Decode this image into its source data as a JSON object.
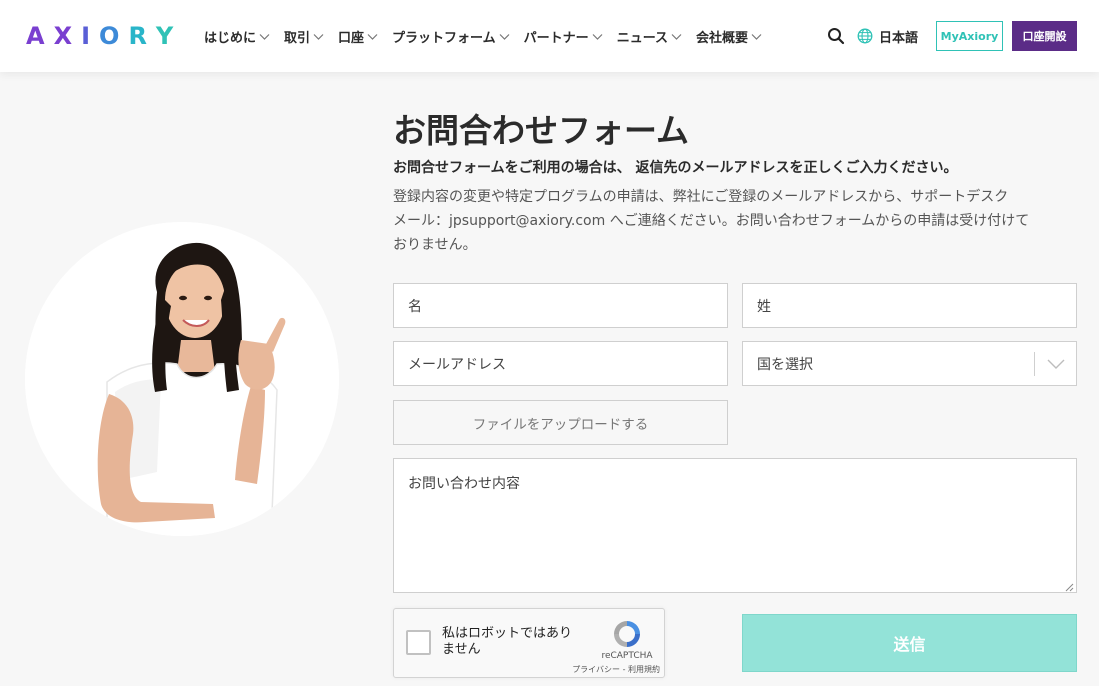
{
  "header": {
    "logo_letters": [
      "A",
      "X",
      "I",
      "O",
      "R",
      "Y"
    ],
    "logo_colors": [
      "#7a3fd0",
      "#7a3fd0",
      "#5a5fd6",
      "#3d8ad8",
      "#29b5c9",
      "#2fc2b6"
    ],
    "nav": [
      {
        "label": "はじめに"
      },
      {
        "label": "取引"
      },
      {
        "label": "口座"
      },
      {
        "label": "プラットフォーム"
      },
      {
        "label": "パートナー"
      },
      {
        "label": "ニュース"
      },
      {
        "label": "会社概要"
      }
    ],
    "language": "日本語",
    "myaxiory_label": "MyAxiory",
    "open_account_label": "口座開設",
    "brand_purple": "#5b2c87",
    "brand_teal": "#2fc2b6"
  },
  "main": {
    "title": "お問合わせフォーム",
    "lead": "お問合せフォームをご利用の場合は、 返信先のメールアドレスを正しくご入力ください。",
    "description_lines": [
      "登録内容の変更や特定プログラムの申請は、弊社にご登録のメールアドレスから、サポートデスク",
      "メール：jpsupport@axiory.com へご連絡ください。お問い合わせフォームからの申請は受け付けて",
      "おりません。"
    ]
  },
  "form": {
    "first_name_placeholder": "名",
    "last_name_placeholder": "姓",
    "email_placeholder": "メールアドレス",
    "country_selected": "国を選択",
    "upload_label": "ファイルをアップロードする",
    "message_placeholder": "お問い合わせ内容",
    "captcha_label": "私はロボットではありません",
    "captcha_brand": "reCAPTCHA",
    "captcha_links": "プライバシー - 利用規約",
    "submit_label": "送信",
    "submit_color": "#93e3d8"
  }
}
